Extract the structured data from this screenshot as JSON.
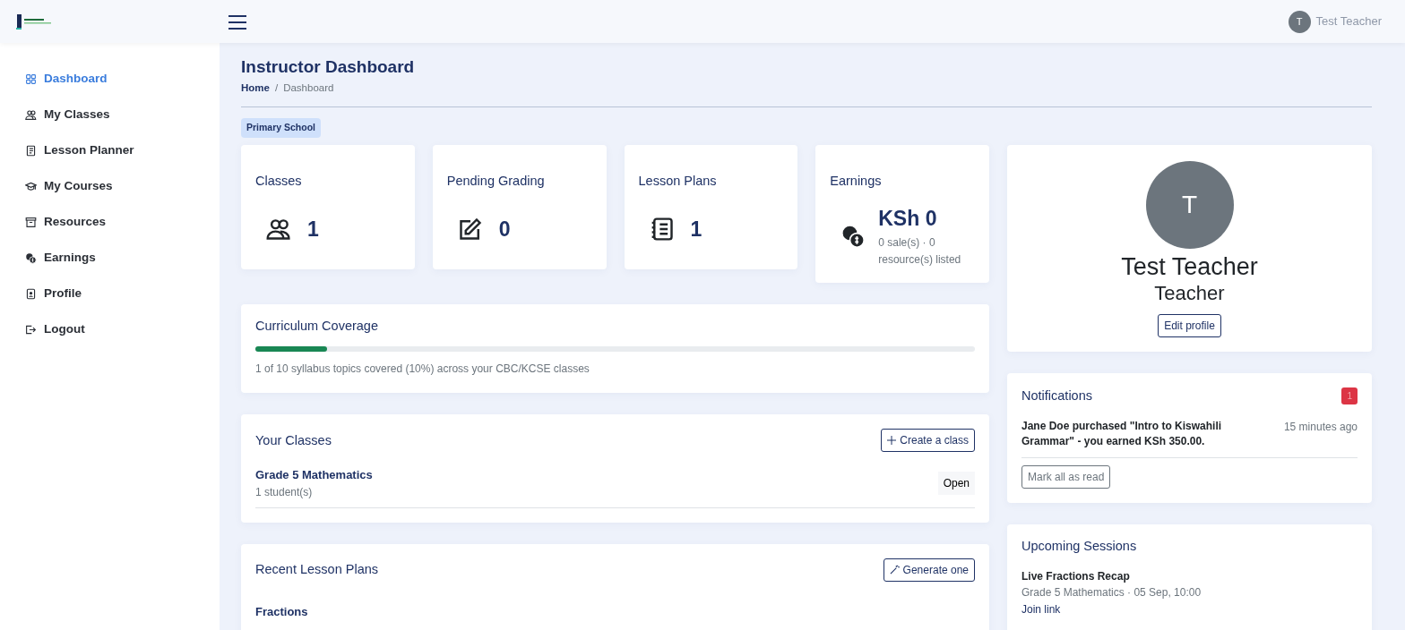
{
  "header": {
    "user_initial": "T",
    "user_name": "Test Teacher"
  },
  "sidebar": {
    "items": [
      {
        "label": "Dashboard",
        "selected": true
      },
      {
        "label": "My Classes",
        "selected": false
      },
      {
        "label": "Lesson Planner",
        "selected": false
      },
      {
        "label": "My Courses",
        "selected": false
      },
      {
        "label": "Resources",
        "selected": false
      },
      {
        "label": "Earnings",
        "selected": false
      },
      {
        "label": "Profile",
        "selected": false
      },
      {
        "label": "Logout",
        "selected": false
      }
    ]
  },
  "page": {
    "title": "Instructor Dashboard",
    "breadcrumb_separator": "/",
    "breadcrumb": [
      {
        "label": "Home",
        "kind": "link"
      },
      {
        "label": "Dashboard",
        "kind": "current"
      }
    ],
    "badge": "Primary School"
  },
  "stats": [
    {
      "title": "Classes",
      "value": "1"
    },
    {
      "title": "Pending Grading",
      "value": "0"
    },
    {
      "title": "Lesson Plans",
      "value": "1"
    },
    {
      "title": "Earnings",
      "value": "KSh 0",
      "note": "0 sale(s) · 0 resource(s) listed"
    }
  ],
  "coverage": {
    "title": "Curriculum Coverage",
    "level": 0.1,
    "caption": "1 of 10 syllabus topics covered (10%) across your CBC/KCSE classes"
  },
  "classes": {
    "title": "Your Classes",
    "button": "Create a class",
    "rows": [
      {
        "name": "Grade 5 Mathematics",
        "meta": "1 student(s)",
        "action": "Open"
      }
    ]
  },
  "lesson_plans": {
    "title": "Recent Lesson Plans",
    "button": "Generate one",
    "rows": [
      {
        "name": "Fractions"
      }
    ]
  },
  "profile": {
    "initial": "T",
    "name": "Test Teacher",
    "role": "Teacher",
    "button": "Edit profile"
  },
  "notifications": {
    "title": "Notifications",
    "count": "1",
    "items": [
      {
        "text": "Jane Doe purchased \"Intro to Kiswahili Grammar\" - you earned KSh 350.00.",
        "time": "15 minutes ago"
      }
    ],
    "button": "Mark all as read"
  },
  "sessions": {
    "title": "Upcoming Sessions",
    "items": [
      {
        "title": "Live Fractions Recap",
        "meta": "Grade 5 Mathematics · 05 Sep, 10:00",
        "link": "Join link"
      }
    ]
  }
}
